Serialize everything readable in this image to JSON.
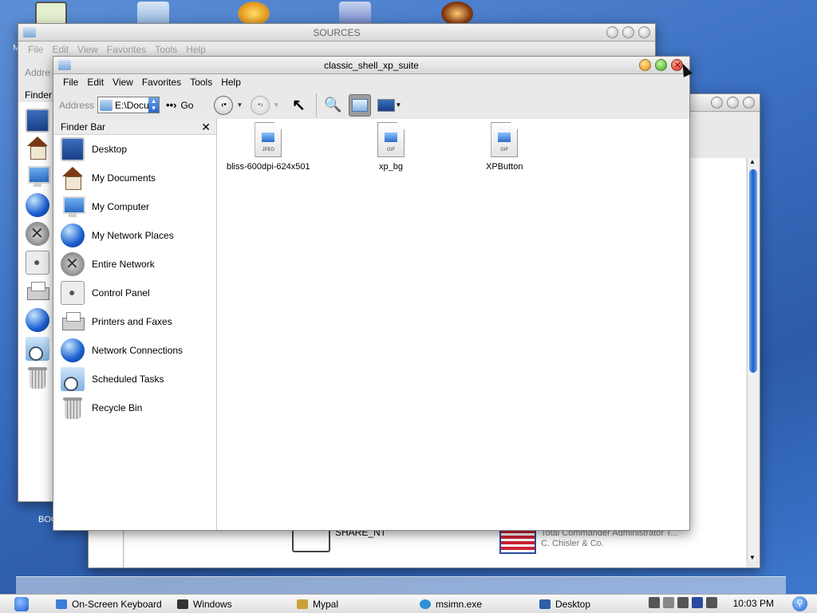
{
  "desktop": {
    "partial_label_left": "M",
    "partial_label_bottom": "BOO"
  },
  "sources_window": {
    "title": "SOURCES",
    "menu": [
      "File",
      "Edit",
      "View",
      "Favorites",
      "Tools",
      "Help"
    ],
    "address_label": "Addre",
    "finder_label": "Finder"
  },
  "back_window": {
    "items": [
      {
        "name": "SHARE_NT",
        "sub": ""
      },
      {
        "name": "Total Commander Administrator T...",
        "sub": "C. Chisler & Co."
      }
    ]
  },
  "main_window": {
    "title": "classic_shell_xp_suite",
    "menu": [
      "File",
      "Edit",
      "View",
      "Favorites",
      "Tools",
      "Help"
    ],
    "toolbar": {
      "address_label": "Address",
      "address_value": "E:\\Docu",
      "go_label": "Go"
    },
    "finder_bar": {
      "title": "Finder Bar",
      "items": [
        {
          "label": "Desktop",
          "icon": "desktop-icon"
        },
        {
          "label": "My Documents",
          "icon": "home-icon"
        },
        {
          "label": "My Computer",
          "icon": "computer-icon"
        },
        {
          "label": "My Network Places",
          "icon": "globe-icon"
        },
        {
          "label": "Entire Network",
          "icon": "network-x-icon"
        },
        {
          "label": "Control Panel",
          "icon": "control-panel-icon"
        },
        {
          "label": "Printers and Faxes",
          "icon": "printer-icon"
        },
        {
          "label": "Network Connections",
          "icon": "globe-icon"
        },
        {
          "label": "Scheduled Tasks",
          "icon": "clock-icon"
        },
        {
          "label": "Recycle Bin",
          "icon": "trash-icon"
        }
      ]
    },
    "files": [
      {
        "name": "bliss-600dpi-624x501",
        "type": "JPEG"
      },
      {
        "name": "xp_bg",
        "type": "GIF"
      },
      {
        "name": "XPButton",
        "type": "GIF"
      }
    ]
  },
  "taskbar": {
    "tasks": [
      {
        "label": "On-Screen Keyboard",
        "color": "#3b7dd8"
      },
      {
        "label": "Windows",
        "color": "#333333"
      },
      {
        "label": "Mypal",
        "color": "#c9a13b"
      },
      {
        "label": "msimn.exe",
        "color": "#2f8fd8"
      },
      {
        "label": "Desktop",
        "color": "#2f5fa8"
      }
    ],
    "clock": "10:03 PM"
  }
}
